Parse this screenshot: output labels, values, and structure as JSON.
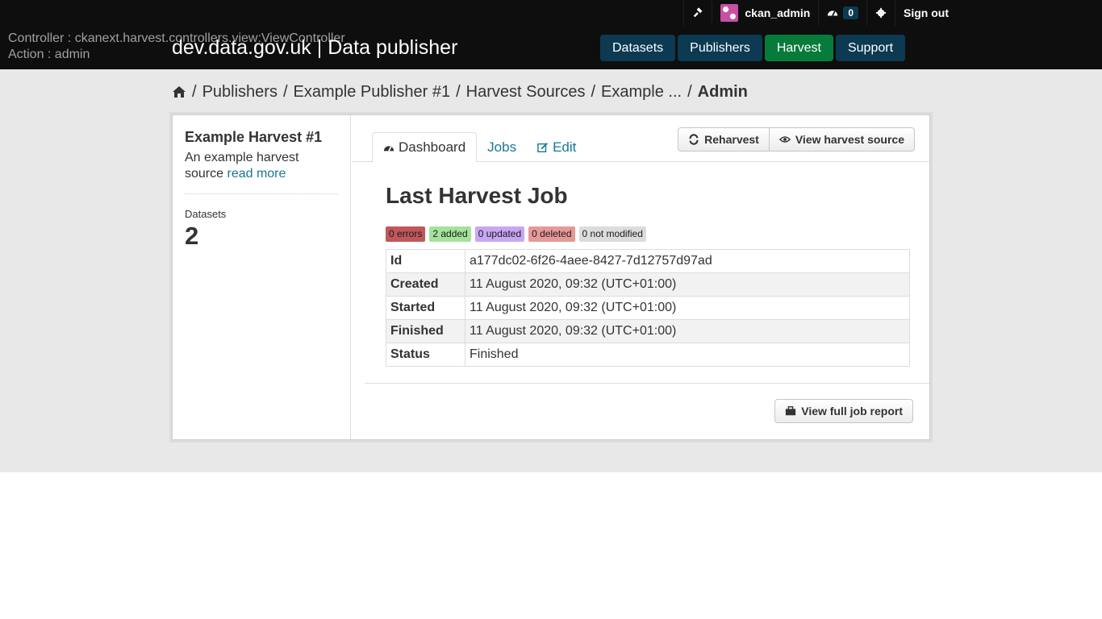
{
  "debug": {
    "controller": "Controller : ckanext.harvest.controllers.view:ViewController",
    "action": "Action : admin"
  },
  "site": {
    "title": "dev.data.gov.uk | Data publisher"
  },
  "account": {
    "username": "ckan_admin",
    "dashboard_count": "0",
    "signout_label": "Sign out"
  },
  "nav": {
    "items": [
      "Datasets",
      "Publishers",
      "Harvest",
      "Support"
    ],
    "active": "Harvest"
  },
  "breadcrumb": {
    "items": [
      "Publishers",
      "Example Publisher #1",
      "Harvest Sources",
      "Example ...",
      "Admin"
    ]
  },
  "sidebar": {
    "title": "Example Harvest #1",
    "description": "An example harvest source",
    "read_more": "read more",
    "stat_label": "Datasets",
    "stat_value": "2"
  },
  "tabs": {
    "dashboard": "Dashboard",
    "jobs": "Jobs",
    "edit": "Edit"
  },
  "actions": {
    "reharvest": "Reharvest",
    "view_source": "View harvest source",
    "view_report": "View full job report"
  },
  "job": {
    "title": "Last Harvest Job",
    "statuses": {
      "errors": "0 errors",
      "added": "2 added",
      "updated": "0 updated",
      "deleted": "0 deleted",
      "not_modified": "0 not modified"
    },
    "rows": [
      {
        "key": "Id",
        "value": "a177dc02-6f26-4aee-8427-7d12757d97ad"
      },
      {
        "key": "Created",
        "value": "11 August 2020, 09:32 (UTC+01:00)"
      },
      {
        "key": "Started",
        "value": "11 August 2020, 09:32 (UTC+01:00)"
      },
      {
        "key": "Finished",
        "value": "11 August 2020, 09:32 (UTC+01:00)"
      },
      {
        "key": "Status",
        "value": "Finished"
      }
    ]
  },
  "colors": {
    "header_bg": "#0e0e0e",
    "nav_bg": "#0b3a52",
    "nav_active": "#067b3a",
    "link": "#187794"
  }
}
